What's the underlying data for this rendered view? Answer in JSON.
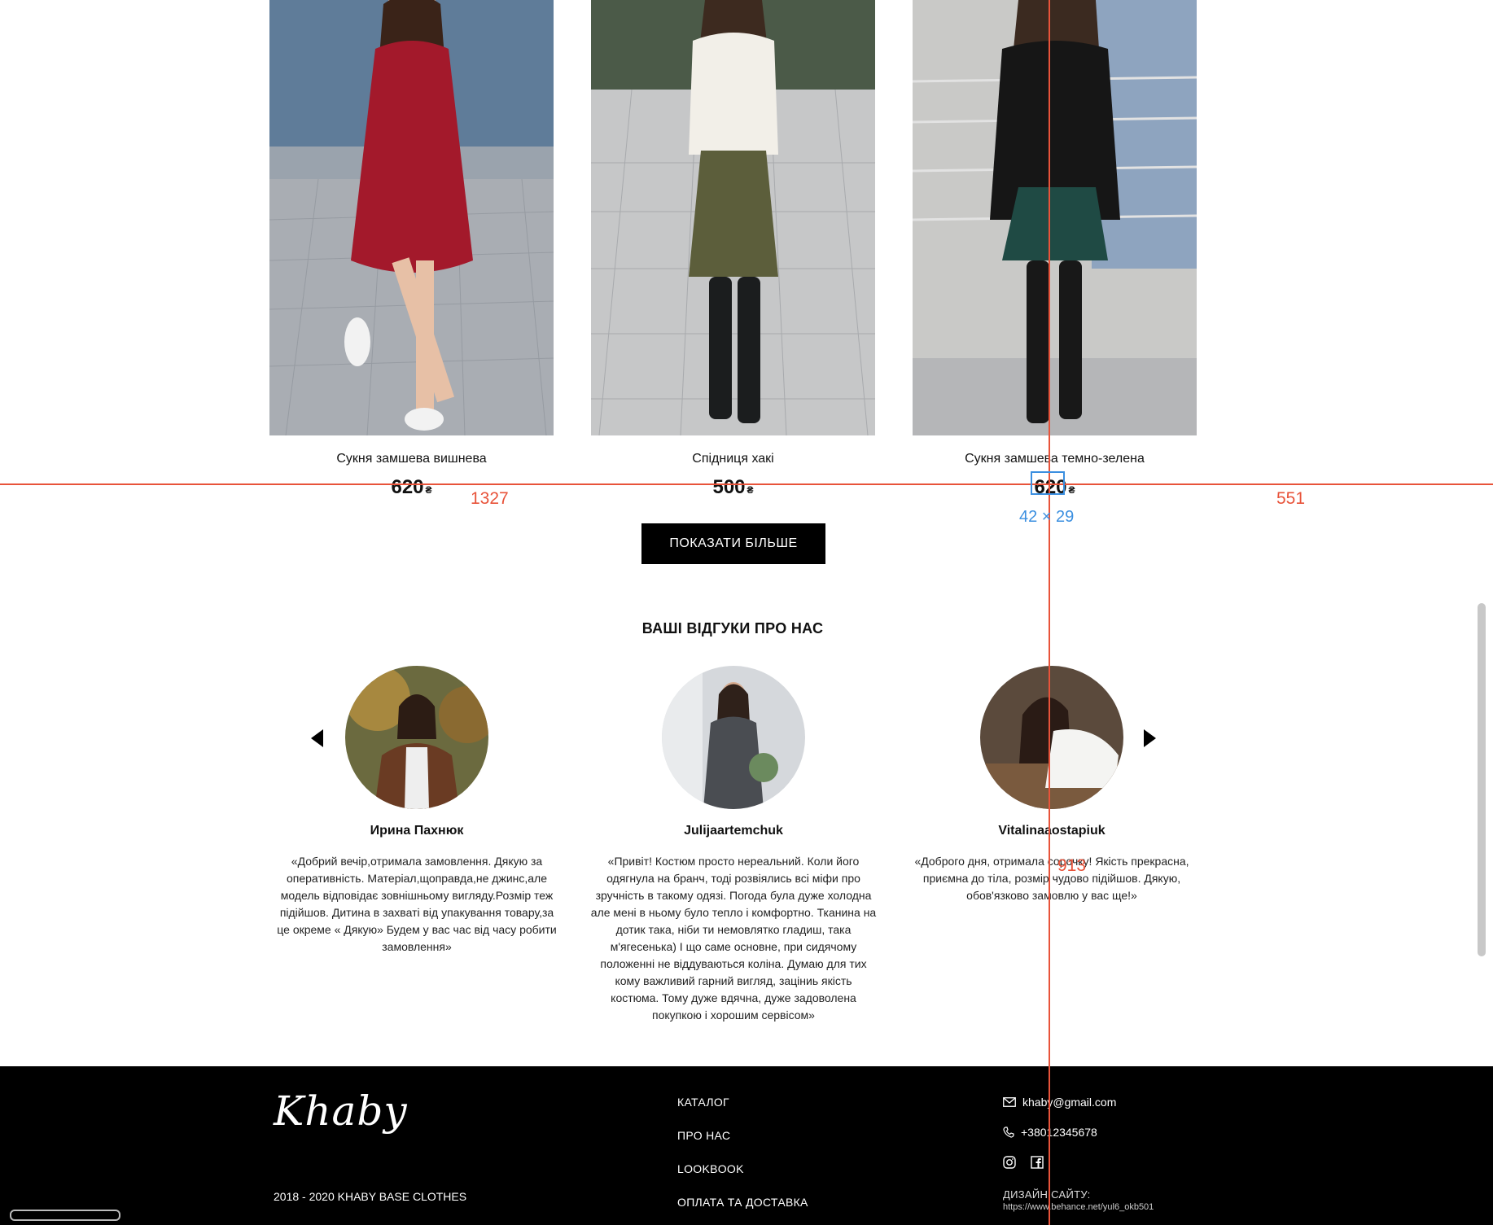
{
  "products": [
    {
      "name": "Сукня замшева вишнева",
      "price": "620",
      "currency": "₴"
    },
    {
      "name": "Спідниця хакі",
      "price": "500",
      "currency": "₴"
    },
    {
      "name": "Сукня замшева темно-зелена",
      "price": "620",
      "currency": "₴"
    }
  ],
  "show_more_label": "ПОКАЗАТИ БІЛЬШЕ",
  "reviews": {
    "title": "ВАШІ ВІДГУКИ ПРО НАС",
    "items": [
      {
        "name": "Ирина Пахнюк",
        "text": "«Добрий вечір,отримала замовлення. Дякую за оперативність. Матеріал,щоправда,не джинс,але модель відповідає зовнішньому вигляду.Розмір теж підійшов. Дитина в захваті від упакування товару,за це окреме « Дякую» Будем у вас час від часу робити замовлення»"
      },
      {
        "name": "Julijaartemchuk",
        "text": "«Привіт! Костюм просто нереальний. Коли його одягнула на бранч, тоді розвіялись всі міфи про зручність в такому одязі. Погода була дуже холодна але мені в ньому було тепло і комфортно. Тканина на дотик така, ніби ти немовлятко гладиш, така м'ягесенька) І що саме основне, при сидячому положенні не віддуваються коліна. Думаю для тих кому важливий гарний вигляд, заціниь якість костюма. Тому дуже вдячна, дуже задоволена покупкою і хорошим сервісом»"
      },
      {
        "name": "Vitalinaaostapiuk",
        "text": "«Доброго дня, отримала сорочку! Якість прекрасна, приємна до тіла, розмір чудово підійшов. Дякую, обов'язково замовлю у вас ще!»"
      }
    ]
  },
  "footer": {
    "logo": "Khaby",
    "copyright": "2018 - 2020  KHABY BASE CLOTHES",
    "menu": [
      "КАТАЛОГ",
      "ПРО НАС",
      "LOOKBOOK",
      "ОПЛАТА ТА ДОСТАВКА"
    ],
    "email": "khaby@gmail.com",
    "phone": "+38012345678",
    "design_label": "ДИЗАЙН САЙТУ:",
    "design_url": "https://www.behance.net/yul6_okb501"
  },
  "overlay": {
    "left_distance": "1327",
    "right_distance": "551",
    "bottom_distance": "913",
    "selection_size": "42 × 29"
  },
  "colors": {
    "guide": "#e8533a",
    "selection": "#3b8fe0",
    "button_bg": "#000000",
    "footer_bg": "#000000"
  }
}
